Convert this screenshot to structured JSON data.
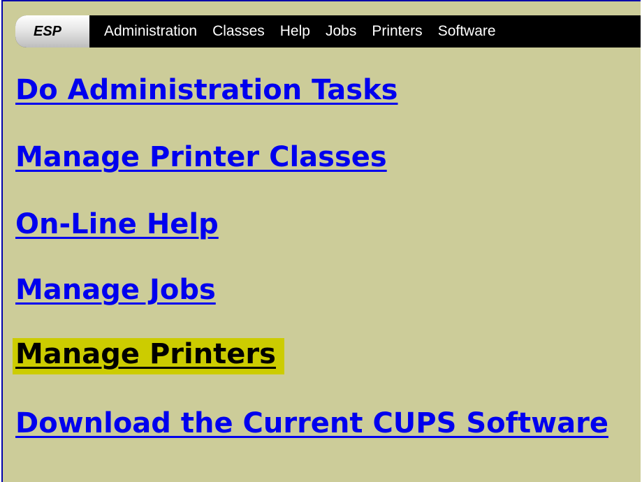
{
  "navbar": {
    "brand": "ESP",
    "items": [
      {
        "label": "Administration"
      },
      {
        "label": "Classes"
      },
      {
        "label": "Help"
      },
      {
        "label": "Jobs"
      },
      {
        "label": "Printers"
      },
      {
        "label": "Software"
      }
    ]
  },
  "links": [
    {
      "label": "Do Administration Tasks"
    },
    {
      "label": "Manage Printer Classes"
    },
    {
      "label": "On-Line Help"
    },
    {
      "label": "Manage Jobs"
    },
    {
      "label": "Manage Printers",
      "state": "highlighted"
    },
    {
      "label": "Download the Current CUPS Software"
    }
  ],
  "colors": {
    "page_background": "#cccc99",
    "link": "#0000ee",
    "highlight": "#cccc00",
    "navbar": "#000000",
    "border": "#0000aa"
  }
}
